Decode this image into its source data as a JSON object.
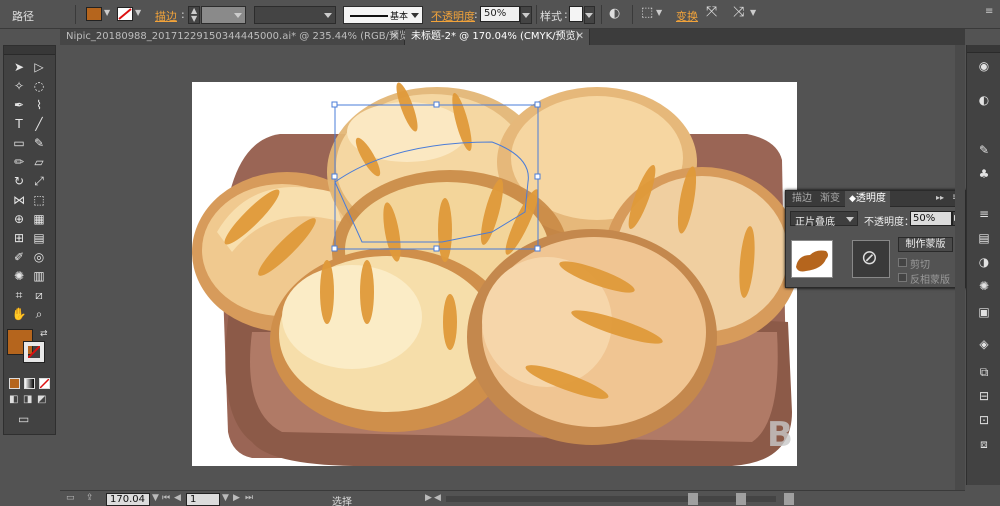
{
  "control_bar": {
    "object_type": "路径",
    "fill_color": "#b5651d",
    "stroke_label": "描边",
    "stroke_width_value": "",
    "brush_value": "",
    "stroke_style": "基本",
    "opacity_label": "不透明度",
    "opacity_value": "50%",
    "style_label": "样式",
    "transform_label": "变换",
    "icons": [
      "fill-swatch-icon",
      "stroke-none-icon",
      "recolor-icon",
      "align-icon",
      "isolate-icon"
    ]
  },
  "tabs": [
    {
      "label": "Nipic_20180988_20171229150344445000.ai* @ 235.44% (RGB/预览)"
    },
    {
      "label": "未标题-2* @ 170.04% (CMYK/预览)"
    }
  ],
  "tools_panel": {
    "fill_color": "#b5651d",
    "stroke_color": "#e8e8e8",
    "icons": [
      "selection-icon",
      "direct-selection-icon",
      "magic-wand-icon",
      "lasso-icon",
      "pen-icon",
      "curvature-icon",
      "type-icon",
      "line-icon",
      "rectangle-icon",
      "paintbrush-icon",
      "pencil-icon",
      "eraser-icon",
      "rotate-icon",
      "scale-icon",
      "width-icon",
      "free-transform-icon",
      "shape-builder-icon",
      "chart-icon",
      "mesh-icon",
      "gradient-icon",
      "eyedropper-icon",
      "blend-icon",
      "symbol-sprayer-icon",
      "column-graph-icon",
      "artboard-icon",
      "slice-icon",
      "hand-icon",
      "zoom-icon"
    ]
  },
  "transparency_panel": {
    "tabs": [
      "描边",
      "渐变",
      "透明度"
    ],
    "active_tab": "透明度",
    "blend_mode": "正片叠底",
    "opacity_label": "不透明度：",
    "opacity_value": "50%",
    "make_mask_button": "制作蒙版",
    "clip_label": "剪切",
    "invert_mask_label": "反相蒙版",
    "clip_checked": false,
    "invert_checked": false,
    "thumbnail_color": "#b5651d"
  },
  "dock": {
    "icons": [
      "color-guide-icon",
      "swatches-icon",
      "brushes-icon",
      "symbols-icon",
      "stroke-icon",
      "gradient-icon",
      "transparency-icon",
      "appearance-icon",
      "graphic-styles-icon",
      "layers-icon",
      "artboards-icon",
      "align-icon",
      "transform-icon",
      "pathfinder-icon"
    ]
  },
  "status_bar": {
    "zoom_value": "170.04",
    "artboard_value": "1",
    "tool_label": "选择"
  },
  "canvas": {
    "watermark": "B"
  }
}
